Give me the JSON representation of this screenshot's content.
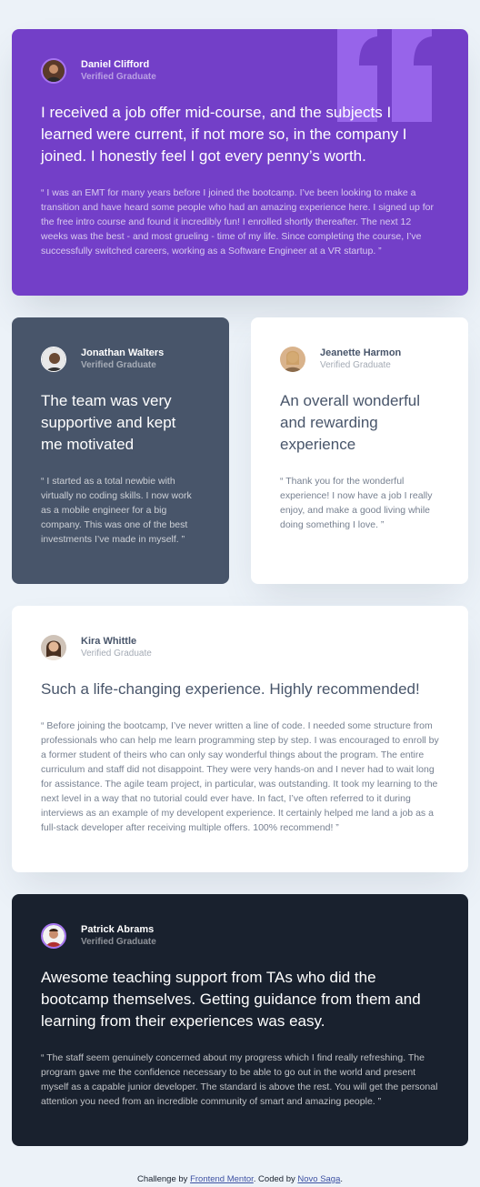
{
  "testimonials": [
    {
      "name": "Daniel Clifford",
      "role": "Verified Graduate",
      "title": "I received a job offer mid-course, and the subjects I learned were current, if not more so, in the company I joined. I honestly feel I got every penny’s worth.",
      "text": "“ I was an EMT for many years before I joined the bootcamp. I’ve been looking to make a transition and have heard some people who had an amazing experience here. I signed up for the free intro course and found it incredibly fun! I enrolled shortly thereafter. The next 12 weeks was the best - and most grueling - time of my life. Since completing the course, I’ve successfully switched careers, working as a Software Engineer at a VR startup. ”"
    },
    {
      "name": "Jonathan Walters",
      "role": "Verified Graduate",
      "title": "The team was very supportive and kept me motivated",
      "text": "“ I started as a total newbie with virtually no coding skills. I now work as a mobile engineer for a big company. This was one of the best investments I’ve made in myself. ”"
    },
    {
      "name": "Jeanette Harmon",
      "role": "Verified Graduate",
      "title": "An overall wonderful and rewarding experience",
      "text": "“ Thank you for the wonderful experience! I now have a job I really enjoy, and make a good living while doing something I love. ”"
    },
    {
      "name": "Kira Whittle",
      "role": "Verified Graduate",
      "title": "Such a life-changing experience. Highly recommended!",
      "text": "“ Before joining the bootcamp, I’ve never written a line of code. I needed some structure from professionals who can help me learn programming step by step. I was encouraged to enroll by a former student of theirs who can only say wonderful things about the program. The entire curriculum and staff did not disappoint. They were very hands-on and I never had to wait long for assistance. The agile team project, in particular, was outstanding. It took my learning to the next level in a way that no tutorial could ever have. In fact, I’ve often referred to it during interviews as an example of my developent experience. It certainly helped me land a job as a full-stack developer after receiving multiple offers. 100% recommend! ”"
    },
    {
      "name": "Patrick Abrams",
      "role": "Verified Graduate",
      "title": "Awesome teaching support from TAs who did the bootcamp themselves. Getting guidance from them and learning from their experiences was easy.",
      "text": "“ The staff seem genuinely concerned about my progress which I find really refreshing. The program gave me the confidence necessary to be able to go out in the world and present myself as a capable junior developer. The standard is above the rest. You will get the personal attention you need from an incredible community of smart and amazing people. ”"
    }
  ],
  "footer": {
    "prefix": "Challenge by ",
    "link1": "Frontend Mentor",
    "middle": ". Coded by ",
    "link2": "Novo Saga",
    "suffix": "."
  },
  "colors": {
    "purple": "#733fc8",
    "slate": "#48556a",
    "white": "#ffffff",
    "dark": "#19212e",
    "background": "#ecf2f8"
  }
}
